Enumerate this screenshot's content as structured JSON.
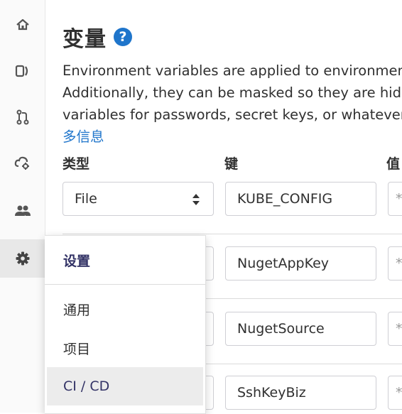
{
  "page": {
    "title": "变量",
    "help_label": "?",
    "description_lines": [
      "Environment variables are applied to environments v",
      "Additionally, they can be masked so they are hidder",
      "variables for passwords, secret keys, or whatever you"
    ],
    "more_link": "多信息"
  },
  "table": {
    "headers": {
      "type": "类型",
      "key": "键",
      "value": "值"
    },
    "rows": [
      {
        "type": "File",
        "key": "KUBE_CONFIG",
        "value_mask": "*"
      },
      {
        "type": "",
        "key": "NugetAppKey",
        "value_mask": "*"
      },
      {
        "type": "",
        "key": "NugetSource",
        "value_mask": "*"
      },
      {
        "type": "",
        "key": "SshKeyBiz",
        "value_mask": "*"
      }
    ]
  },
  "rail": {
    "icons": [
      "home-icon",
      "project-icon",
      "merge-request-icon",
      "deploy-icon",
      "members-icon",
      "settings-icon"
    ],
    "active": "settings-icon"
  },
  "flyout": {
    "header": "设置",
    "items": [
      "通用",
      "项目",
      "CI / CD"
    ],
    "active_item": "CI / CD"
  },
  "colors": {
    "link": "#1f75cb",
    "menu_text_active": "#333366",
    "rail_bg": "#fafafa",
    "rail_active_bg": "#e8e8e8"
  }
}
